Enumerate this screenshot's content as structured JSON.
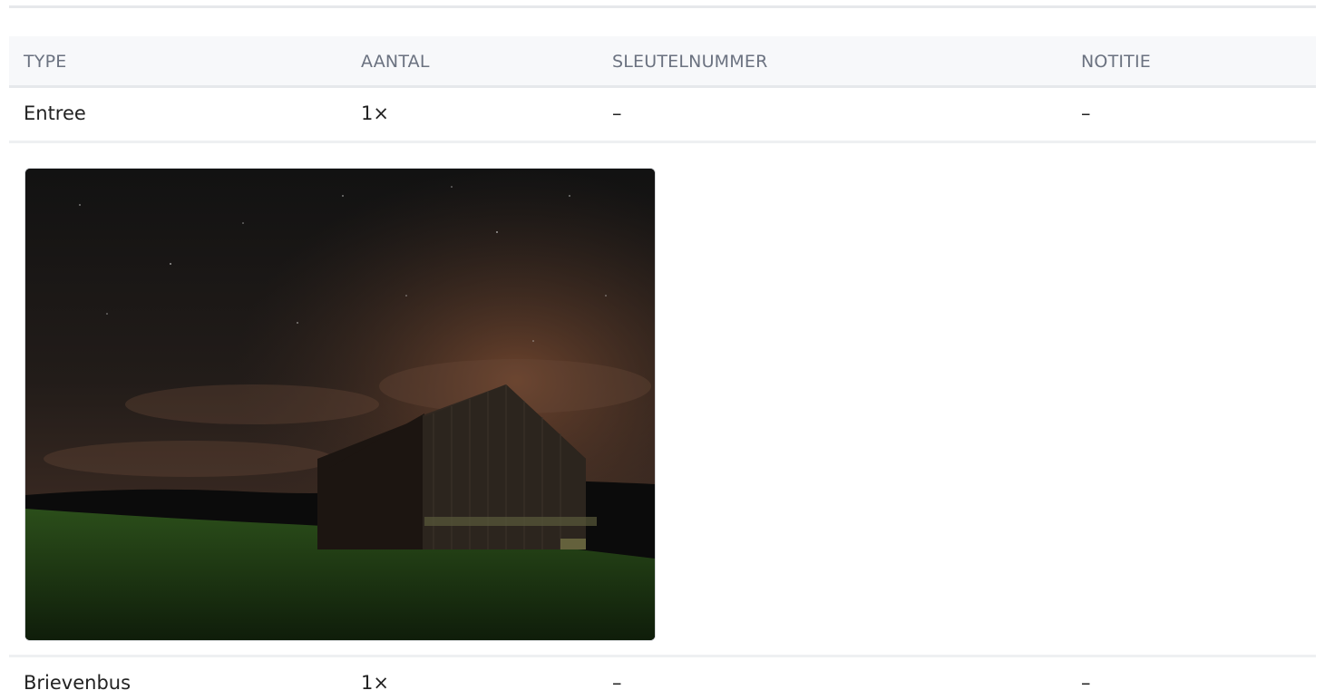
{
  "table": {
    "headers": {
      "type": "TYPE",
      "count": "AANTAL",
      "key_number": "SLEUTELNUMMER",
      "note": "NOTITIE"
    },
    "rows": [
      {
        "type": "Entree",
        "count": "1×",
        "key_number": "–",
        "note": "–"
      },
      {
        "type": "Brievenbus",
        "count": "1×",
        "key_number": "–",
        "note": "–"
      }
    ]
  },
  "photo": {
    "subject": "night-barn-photo",
    "colors": {
      "sky_top": "#141414",
      "sky_glow": "#6b4530",
      "barn": "#2d251d",
      "grass": "#1f3a14"
    }
  }
}
